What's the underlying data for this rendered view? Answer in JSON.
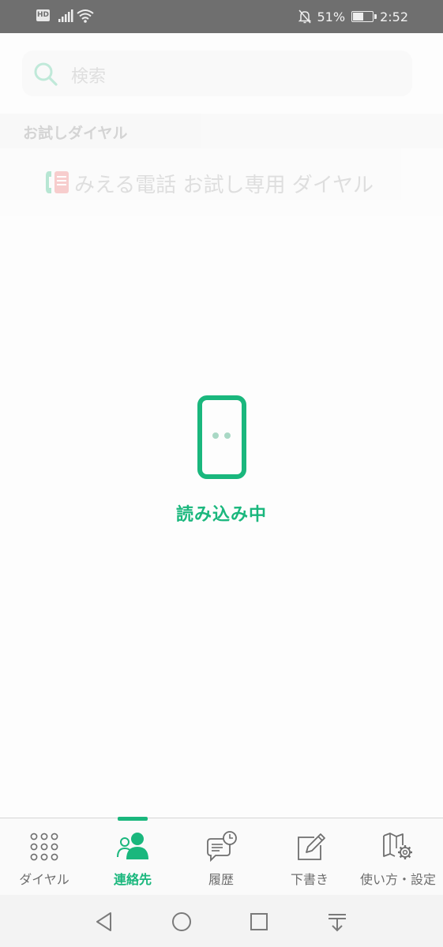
{
  "status_bar": {
    "network_badge": "HD",
    "battery_percent": "51%",
    "battery_level": 0.51,
    "time": "2:52"
  },
  "search": {
    "placeholder": "検索"
  },
  "section": {
    "title": "お試しダイヤル"
  },
  "trial_dial": {
    "label": "みえる電話 お試し専用 ダイヤル"
  },
  "loading": {
    "text": "読み込み中"
  },
  "colors": {
    "accent": "#1ab77d",
    "status_bar": "#6f6f6f",
    "tab_inactive": "#6e6e6e"
  },
  "tabs": [
    {
      "label": "ダイヤル",
      "icon": "dialpad-icon",
      "active": false
    },
    {
      "label": "連絡先",
      "icon": "contacts-icon",
      "active": true
    },
    {
      "label": "履歴",
      "icon": "history-icon",
      "active": false
    },
    {
      "label": "下書き",
      "icon": "draft-icon",
      "active": false
    },
    {
      "label": "使い方・設定",
      "icon": "help-settings-icon",
      "active": false
    }
  ],
  "nav": [
    "back-icon",
    "home-icon",
    "recents-icon",
    "notification-shade-icon"
  ]
}
